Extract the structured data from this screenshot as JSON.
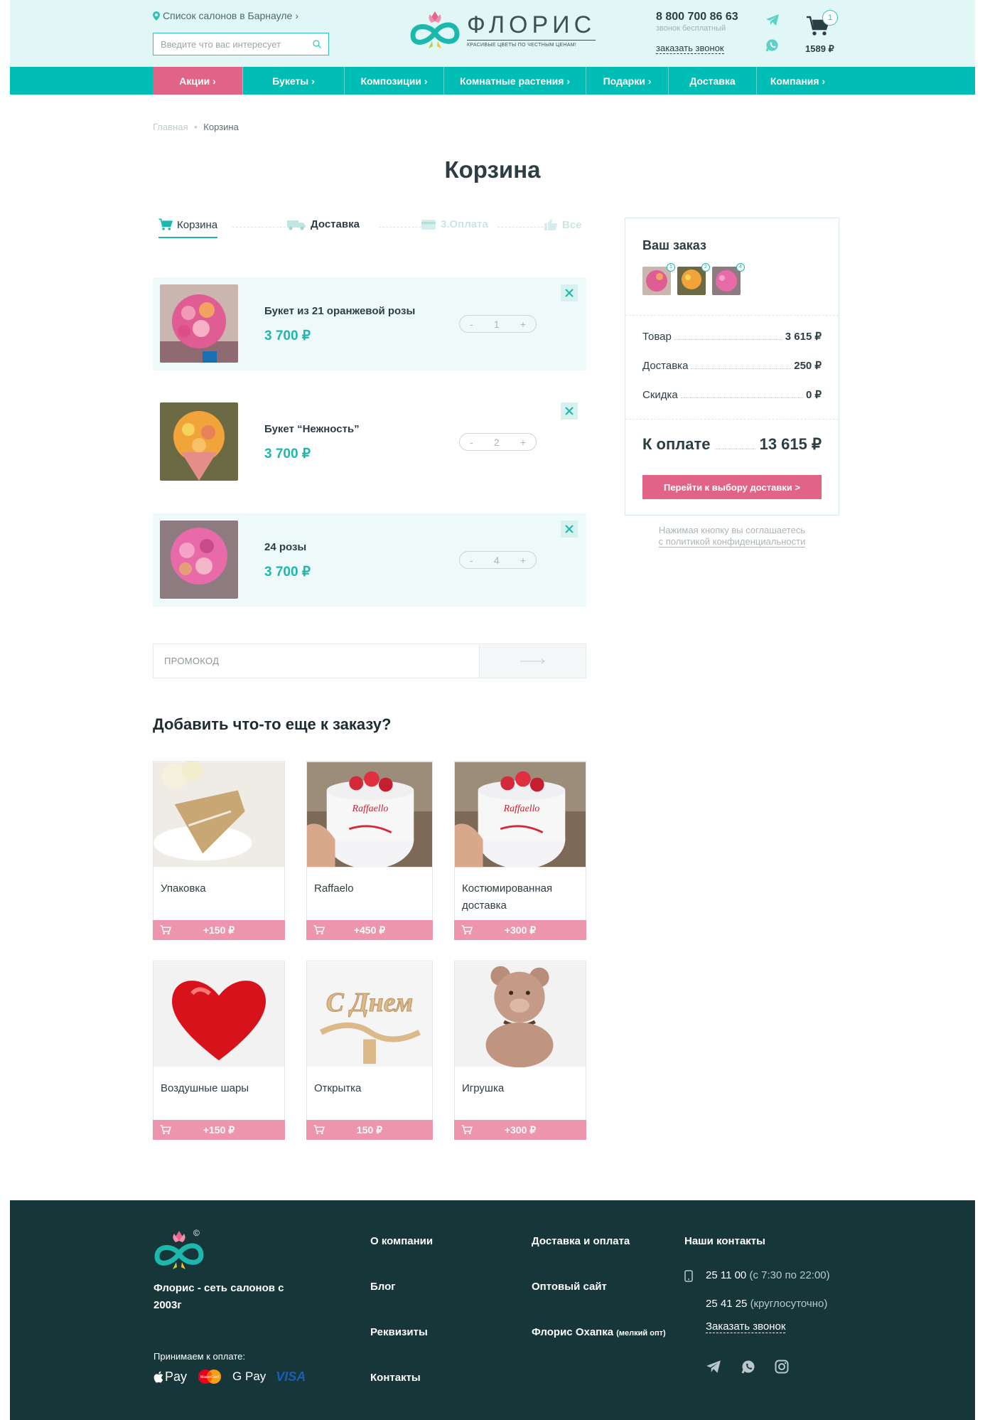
{
  "header": {
    "location_link": "Список салонов в Барнауле",
    "search_placeholder": "Введите что вас интересует",
    "brand_name": "ФЛОРИС",
    "brand_tagline": "КРАСИВЫЕ ЦВЕТЫ ПО ЧЕСТНЫМ ЦЕНАМ!",
    "phone": "8 800 700 86 63",
    "phone_note": "звонок бесплатный",
    "callback": "заказать звонок",
    "cart_count": "1",
    "cart_total": "1589 ₽"
  },
  "nav": [
    {
      "label": "Акции",
      "chevron": "›",
      "active": true
    },
    {
      "label": "Букеты",
      "chevron": "›"
    },
    {
      "label": "Композиции",
      "chevron": "›"
    },
    {
      "label": "Комнатные растения",
      "chevron": "›"
    },
    {
      "label": "Подарки",
      "chevron": "›"
    },
    {
      "label": "Доставка",
      "chevron": ""
    },
    {
      "label": "Компания",
      "chevron": "›"
    }
  ],
  "breadcrumb": {
    "home": "Главная",
    "current": "Корзина"
  },
  "page_title": "Корзина",
  "steps": [
    "Корзина",
    "Доставка",
    "3.Оплата",
    "Все"
  ],
  "cart_items": [
    {
      "name": "Букет из 21 оранжевой розы",
      "price": "3 700 ₽",
      "qty": "1",
      "minus": "-",
      "plus": "+"
    },
    {
      "name": "Букет “Нежность”",
      "price": "3 700 ₽",
      "qty": "2",
      "minus": "-",
      "plus": "+"
    },
    {
      "name": "24 розы",
      "price": "3 700 ₽",
      "qty": "4",
      "minus": "-",
      "plus": "+"
    }
  ],
  "promo_placeholder": "ПРОМОКОД",
  "upsell_title": "Добавить что-то еще к заказу?",
  "upsell": [
    {
      "name": "Упаковка",
      "price": "+150 ₽"
    },
    {
      "name": "Raffaelo",
      "price": "+450 ₽"
    },
    {
      "name": "Костюмированная доставка",
      "price": "+300 ₽"
    },
    {
      "name": "Воздушные шары",
      "price": "+150 ₽"
    },
    {
      "name": "Открытка",
      "price": "150 ₽"
    },
    {
      "name": "Игрушка",
      "price": "+300 ₽"
    }
  ],
  "summary": {
    "title": "Ваш заказ",
    "badges": [
      "1",
      "2",
      "4"
    ],
    "rows": [
      {
        "label": "Товар",
        "value": "3 615 ₽"
      },
      {
        "label": "Доставка",
        "value": "250 ₽"
      },
      {
        "label": "Скидка",
        "value": "0 ₽"
      }
    ],
    "total_label": "К оплате",
    "total_value": "13 615 ₽",
    "button": "Перейти к выбору доставки  >",
    "agree_text": "Нажимая кнопку вы соглашаетесь",
    "agree_link": "с политикой конфиденциальности"
  },
  "footer": {
    "company": "Флорис - сеть салонов с 2003г",
    "payment_title": "Принимаем к оплате:",
    "payments": [
      "Pay",
      "MasterCard",
      "G Pay",
      "VISA"
    ],
    "col1": [
      "О компании",
      "Блог",
      "Реквизиты",
      "Контакты"
    ],
    "col2": [
      "Доставка и оплата",
      "Оптовый сайт",
      "Флорис Охапка"
    ],
    "col2_note": "(мелкий опт)",
    "contacts_title": "Наши контакты",
    "phone1": "25  11 00",
    "phone1_note": "(с 7:30 по 22:00)",
    "phone2": "25 41 25",
    "phone2_note": "(круглосуточно)",
    "callback": "Заказать звонок"
  },
  "colors": {
    "teal": "#00bdb5",
    "pink": "#e16487",
    "footer": "#17363a",
    "tint": "#eef9f9"
  }
}
